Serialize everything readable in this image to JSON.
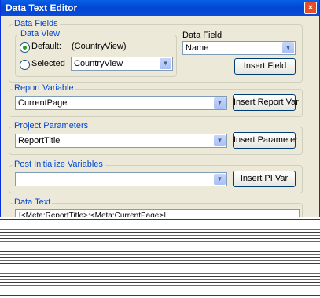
{
  "window": {
    "title": "Data Text Editor",
    "close_glyph": "×"
  },
  "data_fields": {
    "legend": "Data Fields",
    "data_view": {
      "legend": "Data View",
      "default_label": "Default:",
      "default_value": "(CountryView)",
      "selected_label": "Selected",
      "selected_value": "CountryView",
      "selected_option": "default"
    },
    "data_field": {
      "label": "Data Field",
      "value": "Name"
    },
    "insert_field_button": "Insert Field"
  },
  "report_variable": {
    "legend": "Report Variable",
    "value": "CurrentPage",
    "insert_button": "Insert Report Var"
  },
  "project_parameters": {
    "legend": "Project Parameters",
    "value": "ReportTitle",
    "insert_button": "Insert Parameter"
  },
  "post_initialize": {
    "legend": "Post Initialize Variables",
    "value": "",
    "insert_button": "Insert PI Var"
  },
  "data_text": {
    "legend": "Data Text",
    "value": "[<Meta:ReportTitle>:<Meta:CurrentPage>]"
  }
}
